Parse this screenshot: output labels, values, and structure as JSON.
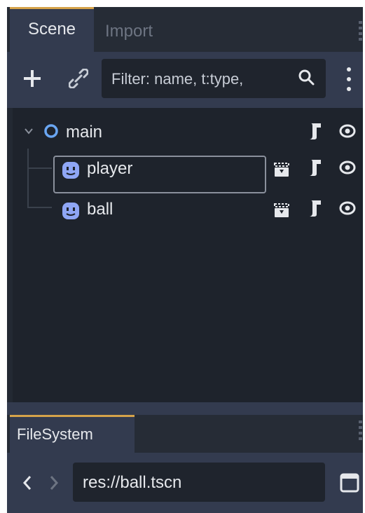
{
  "scene_dock": {
    "tabs": [
      {
        "label": "Scene",
        "active": true
      },
      {
        "label": "Import",
        "active": false
      }
    ],
    "toolbar": {
      "filter_placeholder": "Filter: name, t:type,"
    },
    "tree": [
      {
        "label": "main",
        "node_type_icon": "node-icon",
        "expanded": true,
        "icons": [
          "script-icon",
          "visibility-icon"
        ]
      },
      {
        "label": "player",
        "node_type_icon": "character-body-icon",
        "selected": true,
        "icons": [
          "clapboard-icon",
          "script-icon",
          "visibility-icon"
        ]
      },
      {
        "label": "ball",
        "node_type_icon": "character-body-icon",
        "icons": [
          "clapboard-icon",
          "script-icon",
          "visibility-icon"
        ]
      }
    ]
  },
  "filesystem_dock": {
    "tab_label": "FileSystem",
    "path_value": "res://ball.tscn"
  },
  "colors": {
    "accent": "#d6a34a",
    "node_blue": "#6aa6f2",
    "char_body": "#8fa6f5",
    "background": "#1e232c"
  }
}
